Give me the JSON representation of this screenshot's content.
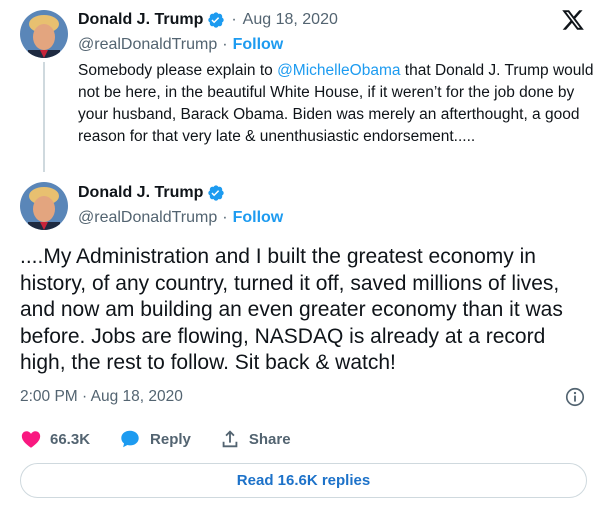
{
  "quoted_tweet": {
    "author_name": "Donald J. Trump",
    "handle": "@realDonaldTrump",
    "follow_label": "Follow",
    "date": "Aug 18, 2020",
    "separator": "·",
    "text_before_mention": "Somebody please explain to ",
    "mention": "@MichelleObama",
    "text_after_mention": " that Donald J. Trump would not be here, in the beautiful White House, if it weren’t for the job done by your husband, Barack Obama. Biden was merely an afterthought, a good reason for that very late &  unenthusiastic endorsement....."
  },
  "main_tweet": {
    "author_name": "Donald J. Trump",
    "handle": "@realDonaldTrump",
    "follow_label": "Follow",
    "separator": "·",
    "text": "....My Administration and I built the greatest economy in history, of any country, turned it off, saved millions of lives, and now am building an even greater economy than it was before. Jobs are flowing, NASDAQ is already at a record high, the rest to follow. Sit back & watch!",
    "timestamp": "2:00 PM · Aug 18, 2020"
  },
  "actions": {
    "like_count": "66.3K",
    "reply_label": "Reply",
    "share_label": "Share"
  },
  "read_replies_label": "Read 16.6K replies",
  "icons": {
    "logo": "x-logo-icon",
    "verified": "verified-badge-icon",
    "like": "heart-icon",
    "reply": "speech-bubble-icon",
    "share": "share-icon",
    "info": "info-icon"
  },
  "colors": {
    "accent": "#1d9bf0",
    "like": "#f91880",
    "muted": "#536471",
    "border": "#cfd9de"
  }
}
